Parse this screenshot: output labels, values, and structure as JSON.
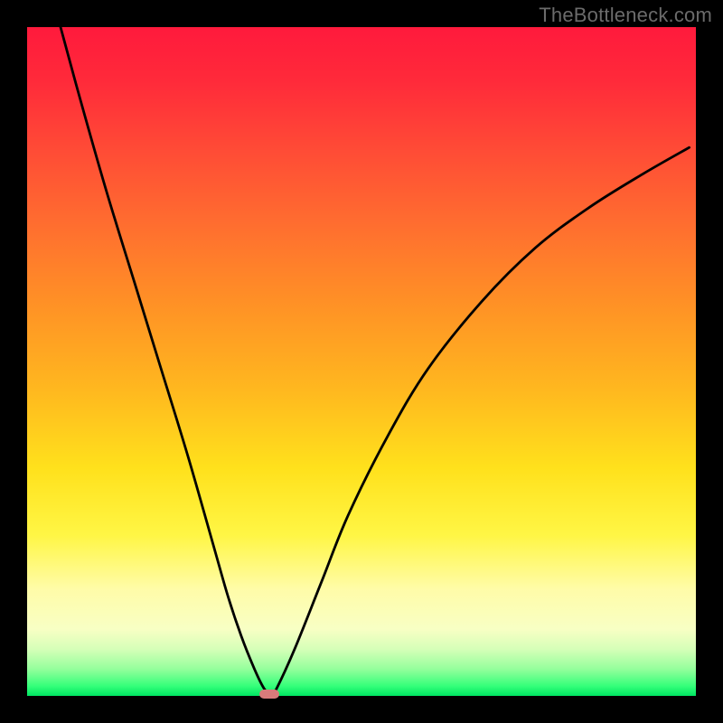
{
  "watermark": "TheBottleneck.com",
  "chart_data": {
    "type": "line",
    "title": "",
    "xlabel": "",
    "ylabel": "",
    "xlim": [
      0,
      100
    ],
    "ylim": [
      0,
      100
    ],
    "grid": false,
    "series": [
      {
        "name": "bottleneck-curve",
        "x": [
          5,
          8,
          12,
          16,
          20,
          24,
          28,
          30,
          32,
          34,
          35.5,
          36.5,
          37,
          40,
          44,
          48,
          54,
          60,
          68,
          76,
          84,
          92,
          99
        ],
        "y": [
          100,
          89,
          75,
          62,
          49,
          36,
          22,
          15,
          9,
          4,
          1,
          0.3,
          0.5,
          7,
          17,
          27,
          39,
          49,
          59,
          67,
          73,
          78,
          82
        ]
      }
    ],
    "annotations": [
      {
        "name": "minimum-marker",
        "x": 36.2,
        "y": 0.3
      }
    ],
    "background_gradient": {
      "top_color": "#ff1a3c",
      "mid_color": "#ffe11c",
      "bottom_color": "#00e763"
    }
  }
}
